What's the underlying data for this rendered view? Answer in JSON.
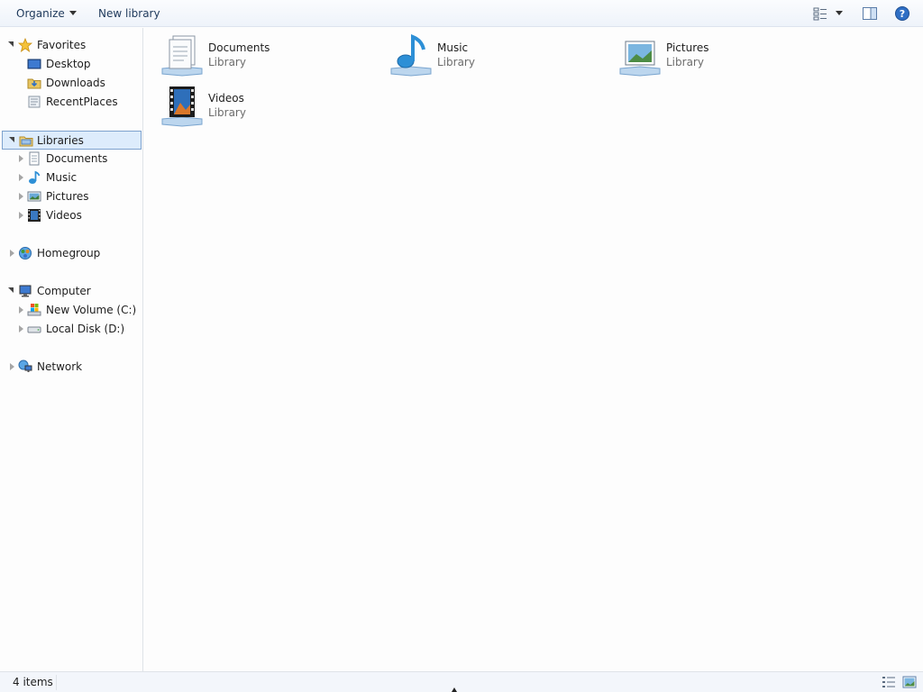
{
  "toolbar": {
    "organize_label": "Organize",
    "new_library_label": "New library",
    "icons": [
      "change-view-icon",
      "preview-pane-icon",
      "help-icon"
    ]
  },
  "nav": {
    "favorites": {
      "label": "Favorites",
      "icon": "star-icon",
      "items": [
        {
          "label": "Desktop",
          "icon": "desktop-icon"
        },
        {
          "label": "Downloads",
          "icon": "downloads-icon"
        },
        {
          "label": "RecentPlaces",
          "icon": "recent-places-icon"
        }
      ]
    },
    "libraries": {
      "label": "Libraries",
      "icon": "libraries-icon",
      "selected": true,
      "items": [
        {
          "label": "Documents",
          "icon": "documents-icon"
        },
        {
          "label": "Music",
          "icon": "music-icon"
        },
        {
          "label": "Pictures",
          "icon": "pictures-icon"
        },
        {
          "label": "Videos",
          "icon": "videos-icon"
        }
      ]
    },
    "homegroup": {
      "label": "Homegroup",
      "icon": "homegroup-icon"
    },
    "computer": {
      "label": "Computer",
      "icon": "computer-icon",
      "items": [
        {
          "label": "New Volume (C:)",
          "icon": "drive-icon"
        },
        {
          "label": "Local Disk (D:)",
          "icon": "disk-icon"
        }
      ]
    },
    "network": {
      "label": "Network",
      "icon": "network-icon"
    }
  },
  "content": {
    "tiles": [
      {
        "name": "Documents",
        "type": "Library",
        "icon": "documents-library-icon"
      },
      {
        "name": "Music",
        "type": "Library",
        "icon": "music-library-icon"
      },
      {
        "name": "Pictures",
        "type": "Library",
        "icon": "pictures-library-icon"
      },
      {
        "name": "Videos",
        "type": "Library",
        "icon": "videos-library-icon"
      }
    ]
  },
  "status": {
    "item_count": "4 items"
  },
  "colors": {
    "selection_bg": "#ddecfc",
    "selection_border": "#7da2ce",
    "command_text": "#1e395b",
    "secondary_text": "#6d6d6d"
  }
}
